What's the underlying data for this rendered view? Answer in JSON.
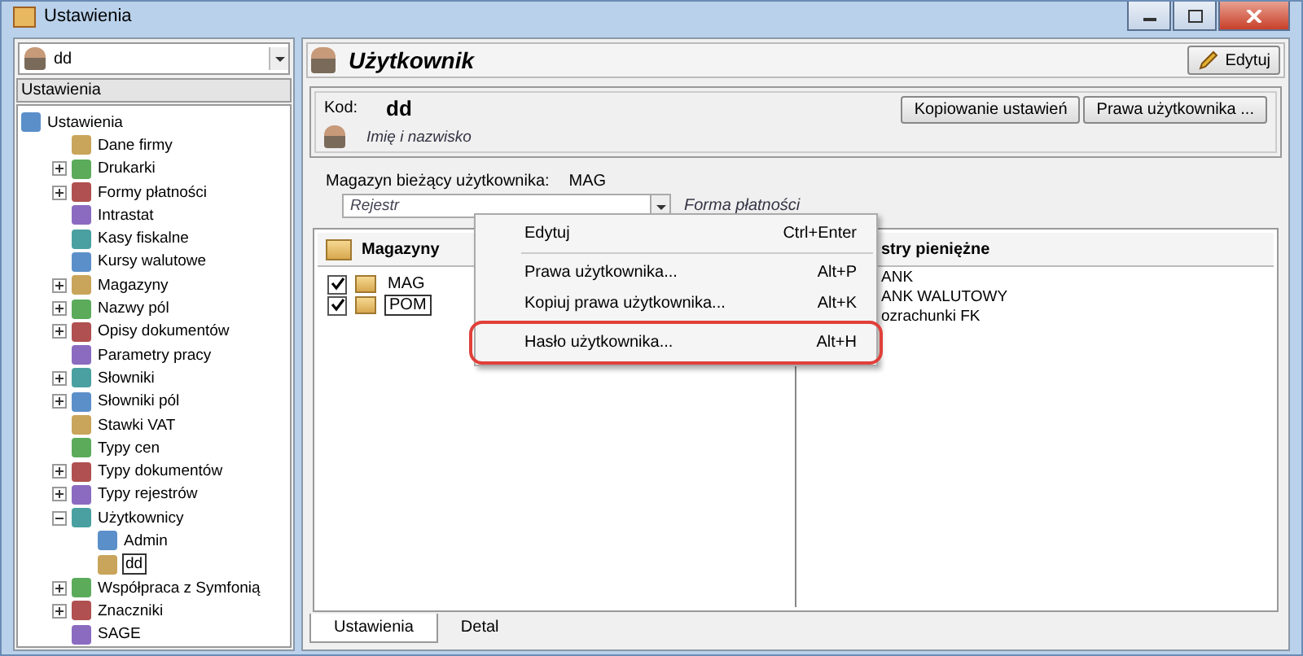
{
  "window": {
    "title": "Ustawienia"
  },
  "sidebar": {
    "user_combo": {
      "value": "dd"
    },
    "header": "Ustawienia",
    "tree": [
      {
        "label": "Ustawienia",
        "selected": false,
        "children": [
          {
            "label": "Dane firmy",
            "selected": false
          },
          {
            "label": "Drukarki",
            "expanded": false,
            "selected": false
          },
          {
            "label": "Formy płatności",
            "expanded": false,
            "selected": false
          },
          {
            "label": "Intrastat",
            "selected": false
          },
          {
            "label": "Kasy fiskalne",
            "selected": false
          },
          {
            "label": "Kursy walutowe",
            "selected": false
          },
          {
            "label": "Magazyny",
            "expanded": false,
            "selected": false
          },
          {
            "label": "Nazwy pól",
            "expanded": false,
            "selected": false
          },
          {
            "label": "Opisy dokumentów",
            "expanded": false,
            "selected": false
          },
          {
            "label": "Parametry pracy",
            "selected": false
          },
          {
            "label": "Słowniki",
            "expanded": false,
            "selected": false
          },
          {
            "label": "Słowniki pól",
            "expanded": false,
            "selected": false
          },
          {
            "label": "Stawki VAT",
            "selected": false
          },
          {
            "label": "Typy cen",
            "selected": false
          },
          {
            "label": "Typy dokumentów",
            "expanded": false,
            "selected": false
          },
          {
            "label": "Typy rejestrów",
            "expanded": false,
            "selected": false
          },
          {
            "label": "Użytkownicy",
            "expanded": true,
            "selected": false,
            "children": [
              {
                "label": "Admin",
                "selected": false
              },
              {
                "label": "dd",
                "selected": true
              }
            ]
          },
          {
            "label": "Współpraca z Symfonią",
            "expanded": false,
            "selected": false
          },
          {
            "label": "Znaczniki",
            "expanded": false,
            "selected": false
          },
          {
            "label": "SAGE",
            "selected": false
          }
        ]
      }
    ]
  },
  "main": {
    "title": "Użytkownik",
    "edit_button": "Edytuj",
    "user_box": {
      "code_label": "Kod:",
      "code": "dd",
      "name_placeholder": "Imię i nazwisko",
      "buttons": [
        "Kopiowanie ustawień",
        "Prawa użytkownika ..."
      ]
    },
    "warehouse_label": "Magazyn bieżący użytkownika:",
    "warehouse_value": "MAG",
    "register_field": {
      "placeholder": "Rejestr"
    },
    "payment_label": "Forma płatności",
    "warehouses": {
      "header": "Magazyny",
      "items": [
        {
          "label": "MAG",
          "checked": true,
          "focused": false
        },
        {
          "label": "POM",
          "checked": true,
          "focused": true
        }
      ]
    },
    "registers": {
      "header": "stry pieniężne",
      "items": [
        "ANK",
        "ANK WALUTOWY",
        "ozrachunki FK"
      ]
    },
    "tabs": [
      {
        "label": "Ustawienia",
        "selected": true
      },
      {
        "label": "Detal",
        "selected": false
      }
    ]
  },
  "context_menu": [
    {
      "kind": "item",
      "label": "Edytuj",
      "shortcut": "Ctrl+Enter",
      "highlighted": false
    },
    {
      "kind": "separator"
    },
    {
      "kind": "item",
      "label": "Prawa użytkownika...",
      "shortcut": "Alt+P",
      "highlighted": false
    },
    {
      "kind": "item",
      "label": "Kopiuj prawa użytkownika...",
      "shortcut": "Alt+K",
      "highlighted": false
    },
    {
      "kind": "separator"
    },
    {
      "kind": "item",
      "label": "Hasło użytkownika...",
      "shortcut": "Alt+H",
      "highlighted": true
    }
  ]
}
